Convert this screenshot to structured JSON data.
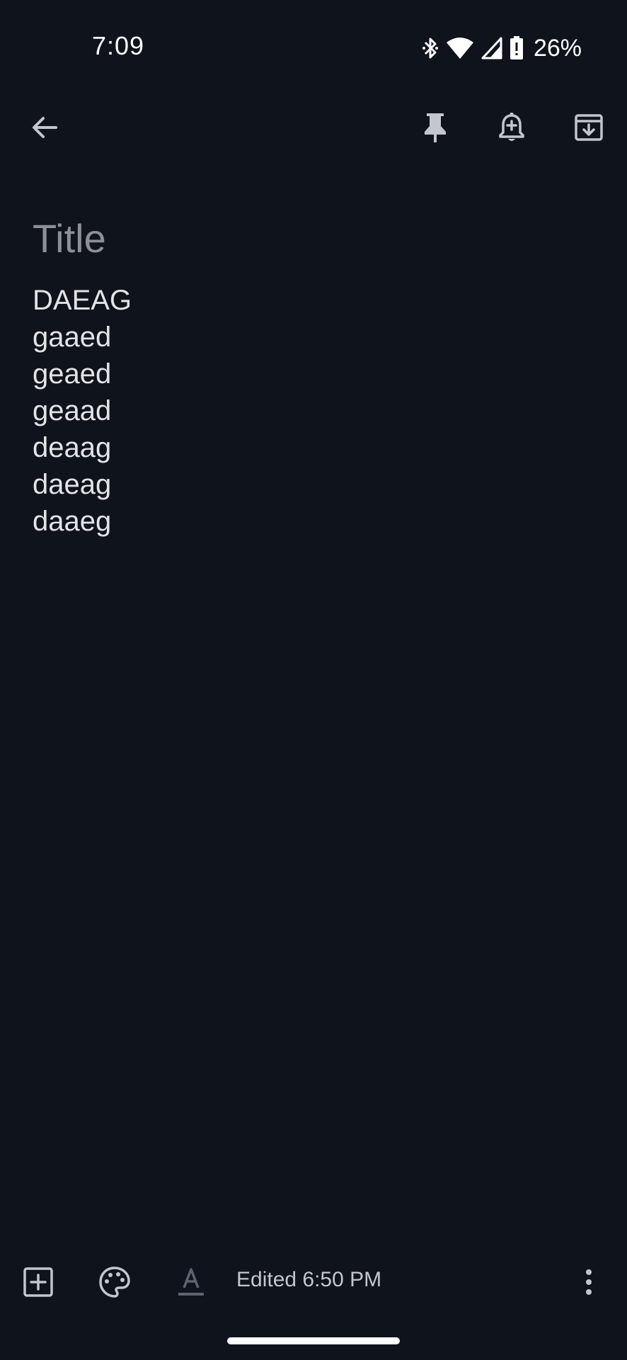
{
  "status_bar": {
    "time": "7:09",
    "battery": "26%",
    "icons": [
      "bluetooth-icon",
      "wifi-icon",
      "cell-signal-icon",
      "battery-alert-icon"
    ]
  },
  "toolbar": {
    "icons": [
      "back-arrow-icon",
      "pin-icon",
      "add-reminder-icon",
      "archive-icon"
    ]
  },
  "note": {
    "title_placeholder": "Title",
    "title_value": "",
    "lines": [
      "DAEAG",
      "gaaed",
      "geaed",
      "geaad",
      "deaag",
      "daeag",
      "daaeg"
    ]
  },
  "bottom_bar": {
    "edited": "Edited 6:50 PM",
    "icons": [
      "add-box-icon",
      "palette-icon",
      "text-format-icon",
      "more-vert-icon"
    ]
  },
  "colors": {
    "background": "#0e131c",
    "text": "#e3e3e6",
    "icon": "#c4c6cf",
    "placeholder": "#8e9099"
  }
}
